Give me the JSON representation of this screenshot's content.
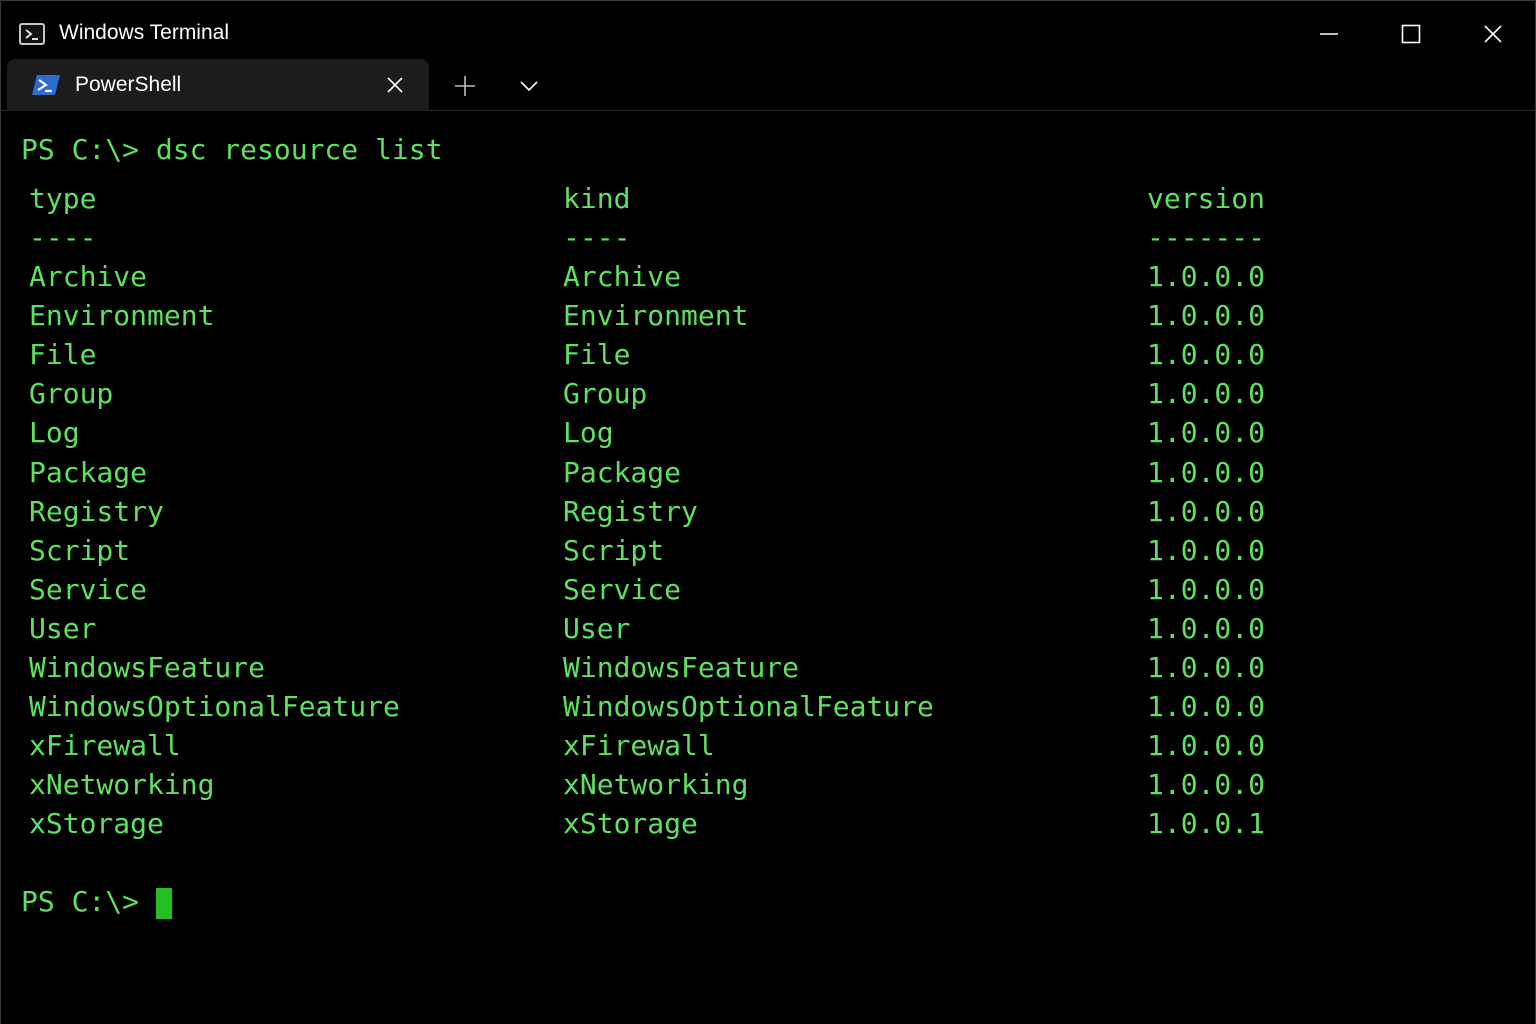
{
  "window": {
    "title": "Windows Terminal",
    "icon": "terminal-icon",
    "controls": [
      "minimize-icon",
      "maximize-icon",
      "close-icon"
    ]
  },
  "tabs": [
    {
      "label": "PowerShell",
      "icon": "powershell-icon",
      "active": true
    }
  ],
  "tabstrip": {
    "new_tab_icon": "plus-icon",
    "dropdown_icon": "chevron-down-icon"
  },
  "terminal": {
    "command_prompt": "PS C:\\> dsc resource list",
    "headers": {
      "type": "type",
      "kind": "kind",
      "version": "version"
    },
    "separators": {
      "type": "----",
      "kind": "----",
      "version": "-------"
    },
    "rows": [
      {
        "type": "Archive",
        "kind": "Archive",
        "version": "1.0.0.0"
      },
      {
        "type": "Environment",
        "kind": "Environment",
        "version": "1.0.0.0"
      },
      {
        "type": "File",
        "kind": "File",
        "version": "1.0.0.0"
      },
      {
        "type": "Group",
        "kind": "Group",
        "version": "1.0.0.0"
      },
      {
        "type": "Log",
        "kind": "Log",
        "version": "1.0.0.0"
      },
      {
        "type": "Package",
        "kind": "Package",
        "version": "1.0.0.0"
      },
      {
        "type": "Registry",
        "kind": "Registry",
        "version": "1.0.0.0"
      },
      {
        "type": "Script",
        "kind": "Script",
        "version": "1.0.0.0"
      },
      {
        "type": "Service",
        "kind": "Service",
        "version": "1.0.0.0"
      },
      {
        "type": "User",
        "kind": "User",
        "version": "1.0.0.0"
      },
      {
        "type": "WindowsFeature",
        "kind": "WindowsFeature",
        "version": "1.0.0.0"
      },
      {
        "type": "WindowsOptionalFeature",
        "kind": "WindowsOptionalFeature",
        "version": "1.0.0.0"
      },
      {
        "type": "xFirewall",
        "kind": "xFirewall",
        "version": "1.0.0.0"
      },
      {
        "type": "xNetworking",
        "kind": "xNetworking",
        "version": "1.0.0.0"
      },
      {
        "type": "xStorage",
        "kind": "xStorage",
        "version": "1.0.0.1"
      }
    ],
    "final_prompt": "PS C:\\>",
    "text_color": "#5fe05f",
    "cursor_color": "#22c022",
    "background": "#000000"
  }
}
